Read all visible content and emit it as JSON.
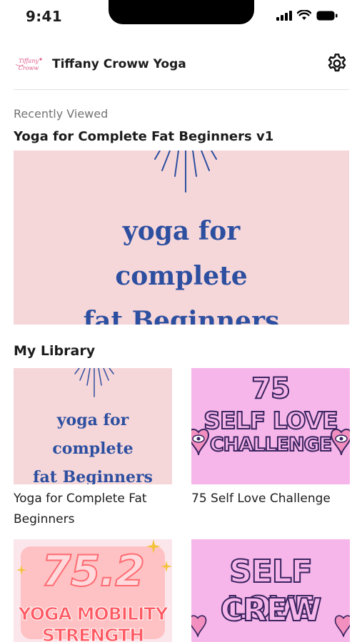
{
  "status_bar": {
    "time": "9:41"
  },
  "header": {
    "logo_text": "Tiffany Croww",
    "app_title": "Tiffany Croww Yoga"
  },
  "recent": {
    "caption": "Recently Viewed",
    "title": "Yoga for Complete Fat Beginners v1",
    "thumb_lines": [
      "yoga for",
      "complete",
      "fat Beginners"
    ]
  },
  "library": {
    "heading": "My Library",
    "cards": [
      {
        "title": "Yoga for Complete Fat Beginners",
        "thumb_lines": [
          "yoga for",
          "complete",
          "fat Beginners"
        ]
      },
      {
        "title": "75 Self Love Challenge",
        "thumb_lines": [
          "75",
          "SELF LOVE",
          "CHALLENGE"
        ]
      },
      {
        "title": "",
        "thumb_lines": [
          "75.2",
          "YOGA MOBILITY",
          "STRENGTH"
        ]
      },
      {
        "title": "",
        "thumb_lines": [
          "SELF LOVE",
          "CREW"
        ]
      }
    ]
  },
  "colors": {
    "yoga_bg": "#f6d7d9",
    "yoga_text": "#2d4fa0",
    "selflove_bg": "#f6b6ea",
    "outline": "#3a2460",
    "mobility_text": "#ff5a63"
  }
}
